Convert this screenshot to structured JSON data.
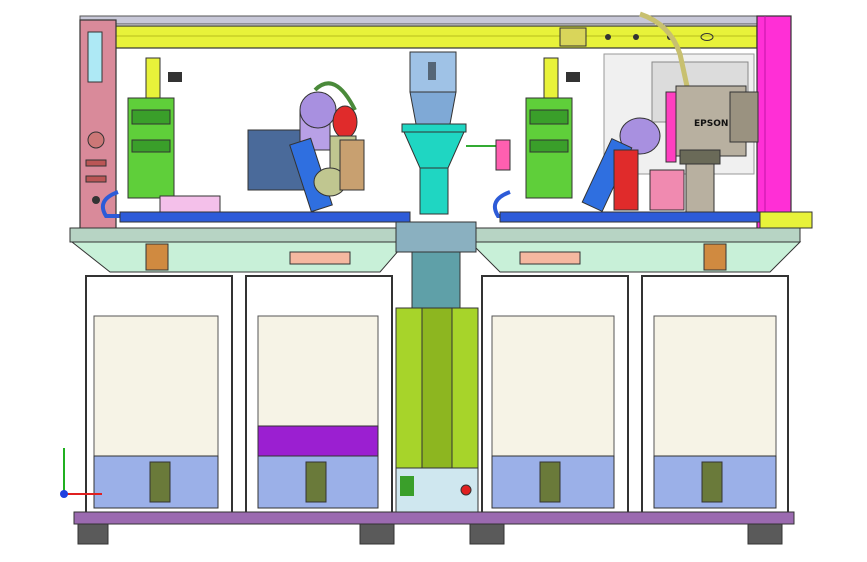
{
  "scene": {
    "view": "front view",
    "background_color": "#ffffff",
    "robot_brand_label": "EPSON",
    "modules": [
      {
        "name": "bay-1",
        "tray_color": "#f6f3e6"
      },
      {
        "name": "bay-2",
        "tray_color": "#f6f3e6",
        "highlight_color": "#9b1fd1"
      },
      {
        "name": "bay-3",
        "tray_color": "#f6f3e6"
      },
      {
        "name": "bay-4",
        "tray_color": "#f6f3e6"
      }
    ]
  },
  "colors": {
    "gantry_beam": "#e8f23a",
    "left_column": "#d98a9a",
    "right_column": "#ff2fd6",
    "frame": "#6b6f8a",
    "conveyor": "#2d5bd8",
    "center_column": "#a7d42a",
    "center_nozzle": "#1fd6c2",
    "robot_body": "#b8b0a0",
    "cobot_link": "#2f6fe0",
    "plate": "#f5f0dc"
  },
  "axes": {
    "x_color": "#e02020",
    "y_color": "#20b020",
    "z_color": "#2040e0"
  }
}
